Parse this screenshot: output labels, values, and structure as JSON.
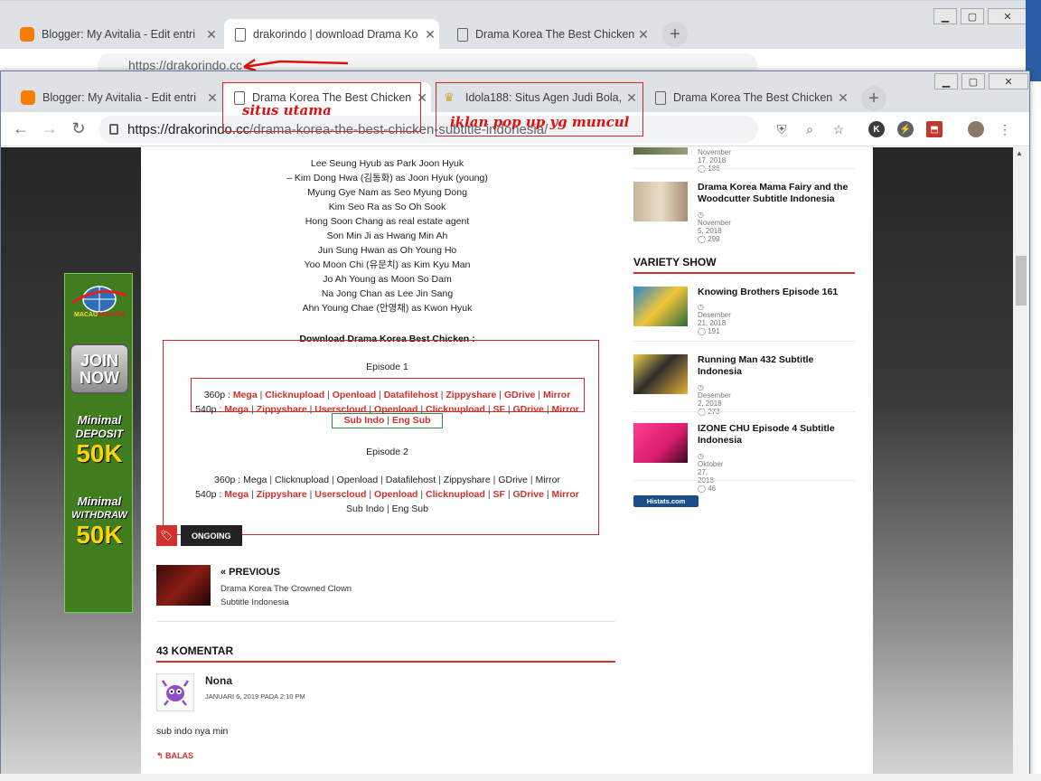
{
  "bg_window": {
    "tabs": [
      {
        "label": "Blogger: My Avitalia - Edit entri",
        "icon": "blogger-icon"
      },
      {
        "label": "drakorindo | download Drama Ko",
        "icon": "document-icon"
      },
      {
        "label": "Drama Korea The Best Chicken S",
        "icon": "document-icon"
      }
    ],
    "url": "https://drakorindo.cc"
  },
  "window": {
    "tabs": [
      {
        "label": "Blogger: My Avitalia - Edit entri",
        "icon": "blogger-icon"
      },
      {
        "label": "Drama Korea The Best Chicken S",
        "icon": "document-icon"
      },
      {
        "label": "Idola188: Situs Agen Judi Bola, S",
        "icon": "crown-icon"
      },
      {
        "label": "Drama Korea The Best Chicken S",
        "icon": "document-icon"
      }
    ],
    "url_host": "https://drakorindo.cc",
    "url_path": "/drama-korea-the-best-chicken-subtitle-indonesia/",
    "extensions": [
      "K",
      "⚡"
    ]
  },
  "annotations": {
    "main_site": "situs utama",
    "popup_ad": "iklan pop up yg muncul"
  },
  "article": {
    "cast": [
      "Lee Seung Hyub as Park Joon Hyuk",
      "– Kim Dong Hwa (김동화) as Joon Hyuk (young)",
      "Myung Gye Nam as Seo Myung Dong",
      "Kim Seo Ra as So Oh Sook",
      "Hong Soon Chang as real estate agent",
      "Son Min Ji as Hwang Min Ah",
      "Jun Sung Hwan as Oh Young Ho",
      "Yoo Moon Chi (유문치) as Kim Kyu Man",
      "Jo Ah Young as Moon So Dam",
      "Na Jong Chan as Lee Jin Sang",
      "Ahn Young Chae (안영채) as Kwon Hyuk"
    ],
    "download_title": "Download Drama Korea Best Chicken :",
    "episode1": "Episode 1",
    "episode2": "Episode 2",
    "ep1_360_prefix": "360p :",
    "ep1_360_links": [
      "Mega",
      "Clicknupload",
      "Openload",
      "Datafilehost",
      "Zippyshare",
      "GDrive",
      "Mirror"
    ],
    "ep1_540_prefix": "540p :",
    "ep1_540_links": [
      "Mega",
      "Zippyshare",
      "Userscloud",
      "Openload",
      "Clicknupload",
      "SF",
      "GDrive",
      "Mirror"
    ],
    "ep1_subs": [
      "Sub Indo",
      "Eng Sub"
    ],
    "ep2_360_prefix": "360p :",
    "ep2_360_links": [
      "Mega",
      "Clicknupload",
      "Openload",
      "Datafilehost",
      "Zippyshare",
      "GDrive",
      "Mirror"
    ],
    "ep2_540_prefix": "540p :",
    "ep2_540_links": [
      "Mega",
      "Zippyshare",
      "Userscloud",
      "Openload",
      "Clicknupload",
      "SF",
      "GDrive",
      "Mirror"
    ],
    "ep2_subs": [
      "Sub Indo",
      "Eng Sub"
    ],
    "tag": "ONGOING",
    "prev_label": "« PREVIOUS",
    "prev_title": "Drama Korea The Crowned Clown Subtitle Indonesia",
    "comments_heading": "43 KOMENTAR",
    "comment": {
      "author": "Nona",
      "date": "JANUARI 6, 2019 PADA 2:10 PM",
      "text": "sub indo nya min",
      "reply": "BALAS"
    }
  },
  "sidebar": {
    "top_meta": "November 17, 2018",
    "top_count": "186",
    "item1": {
      "title": "Drama Korea Mama Fairy and the Woodcutter Subtitle Indonesia",
      "date": "November 5, 2018",
      "count": "299"
    },
    "variety_heading": "VARIETY SHOW",
    "variety": [
      {
        "title": "Knowing Brothers Episode 161",
        "date": "Desember 21, 2018",
        "count": "191"
      },
      {
        "title": "Running Man 432 Subtitle Indonesia",
        "date": "Desember 2, 2018",
        "count": "273"
      },
      {
        "title": "IZONE CHU Episode 4 Subtitle Indonesia",
        "date": "Oktober 27, 2018",
        "count": "46"
      }
    ],
    "histats": "Histats.com"
  },
  "ad": {
    "brand": "MACAU",
    "brand2": "303.COM",
    "join": "JOIN NOW",
    "min_deposit_1": "Minimal",
    "min_deposit_2": "DEPOSIT",
    "min_deposit_amount": "50K",
    "min_withdraw_1": "Minimal",
    "min_withdraw_2": "WITHDRAW",
    "min_withdraw_amount": "50K"
  },
  "colors": {
    "accent": "#d0312d",
    "annotation": "#e01010",
    "ad_green": "#3f7d1f"
  }
}
